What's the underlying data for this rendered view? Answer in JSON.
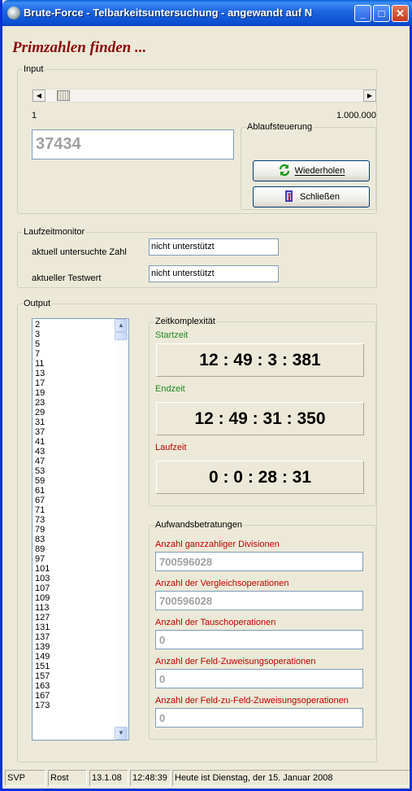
{
  "window": {
    "title": "Brute-Force - Telbarkeitsuntersuchung - angewandt auf N",
    "min": "_",
    "max": "□",
    "close": "✕"
  },
  "heading": "Primzahlen finden ...",
  "input": {
    "legend": "Input",
    "slider_min_label": "1",
    "slider_max_label": "1.000.000",
    "slider_value_fraction": 0.037434,
    "value": "37434"
  },
  "ablauf": {
    "legend": "Ablaufsteuerung",
    "repeat_button": "Wiederholen",
    "close_button": "Schließen"
  },
  "monitor": {
    "legend": "Laufzeitmonitor",
    "current_number_label": "aktuell untersuchte Zahl",
    "current_number_value": "nicht unterstützt",
    "test_value_label": "aktueller Testwert",
    "test_value_value": "nicht unterstützt"
  },
  "output": {
    "legend": "Output",
    "primes": [
      "2",
      "3",
      "5",
      "7",
      "11",
      "13",
      "17",
      "19",
      "23",
      "29",
      "31",
      "37",
      "41",
      "43",
      "47",
      "53",
      "59",
      "61",
      "67",
      "71",
      "73",
      "79",
      "83",
      "89",
      "97",
      "101",
      "103",
      "107",
      "109",
      "113",
      "127",
      "131",
      "137",
      "139",
      "149",
      "151",
      "157",
      "163",
      "167",
      "173"
    ]
  },
  "zeit": {
    "legend": "Zeitkomplexität",
    "start_label": "Startzeit",
    "start_value": "12 : 49 : 3 : 381",
    "end_label": "Endzeit",
    "end_value": "12 : 49 : 31 : 350",
    "run_label": "Laufzeit",
    "run_value": "0 : 0 : 28 : 31"
  },
  "aufwand": {
    "legend": "Aufwandsbetratungen",
    "divisions_label": "Anzahl ganzzahliger Divisionen",
    "divisions_value": "700596028",
    "compare_label": "Anzahl der Vergleichsoperationen",
    "compare_value": "700596028",
    "swap_label": "Anzahl der Tauschoperationen",
    "swap_value": "0",
    "assign_label": "Anzahl der Feld-Zuweisungsoperationen",
    "assign_value": "0",
    "field_assign_label": "Anzahl der Feld-zu-Feld-Zuweisungsoperationen",
    "field_assign_value": "0"
  },
  "statusbar": {
    "cell1": "SVP",
    "cell2": "Rost",
    "date": "13.1.08",
    "time": "12:48:39",
    "message": "Heute ist Dienstag, der 15. Januar 2008"
  },
  "colors": {
    "heading": "#8b0a0a",
    "green_label": "#208a20",
    "red_label": "#c00000",
    "titlebar": "#0a4fd0"
  }
}
